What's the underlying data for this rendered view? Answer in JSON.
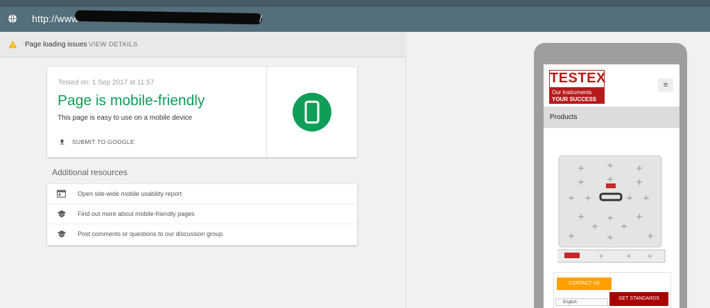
{
  "addressbar": {
    "url_start": "http://www",
    "url_end": "/"
  },
  "issues": {
    "label": "Page loading issues",
    "action": "VIEW DETAILS"
  },
  "result": {
    "tested_on": "Tested on: 1 Sep 2017 at 11:57",
    "title": "Page is mobile-friendly",
    "subtitle": "This page is easy to use on a mobile device",
    "submit_label": "SUBMIT TO GOOGLE"
  },
  "resources": {
    "title": "Additional resources",
    "items": [
      {
        "label": "Open site-wide mobile usability report",
        "icon": "report-icon"
      },
      {
        "label": "Find out more about mobile-friendly pages",
        "icon": "school-icon"
      },
      {
        "label": "Post comments or questions to our discussion group",
        "icon": "school-icon"
      }
    ]
  },
  "preview": {
    "logo_title": "TESTEX",
    "logo_line1": "Our Instruments",
    "logo_line2": "YOUR SUCCESS",
    "menu_glyph": "≡",
    "products_label": "Products",
    "contact_label": "CONTACT US",
    "language_value": "English",
    "get_standards_label": "GET STANDARDS"
  },
  "colors": {
    "topbar": "#546e7a",
    "success": "#0f9d58",
    "warning": "#f4b400",
    "brand": "#b71c1c",
    "contact": "#ffa000"
  }
}
